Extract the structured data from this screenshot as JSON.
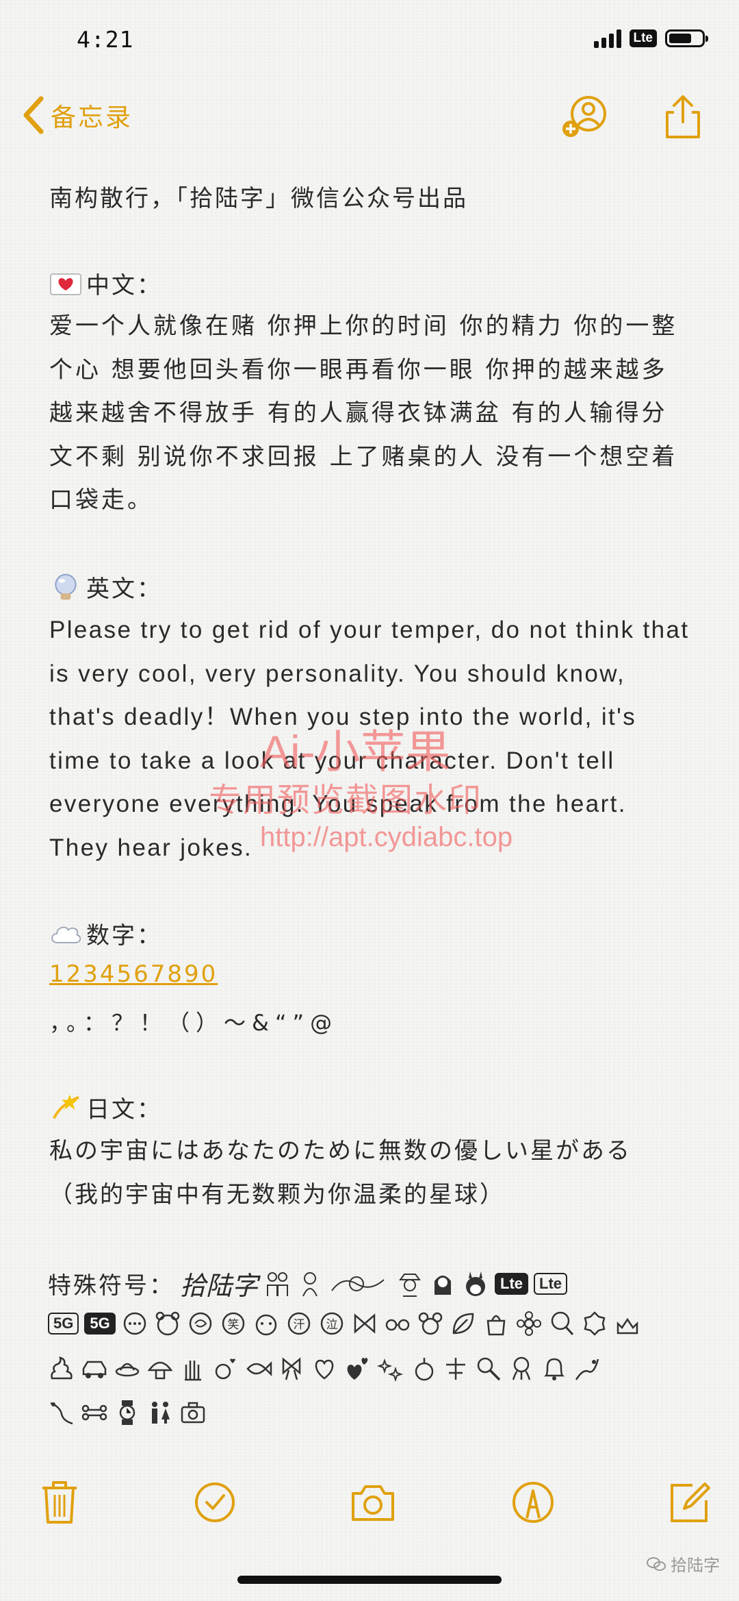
{
  "status": {
    "time": "4:21",
    "network": "Lte",
    "battery_level": 0.7
  },
  "nav": {
    "back_label": "备忘录"
  },
  "note": {
    "intro": "南构散行，「拾陆字」微信公众号出品",
    "zh_heading": "中文：",
    "zh_body": "爱一个人就像在赌 你押上你的时间 你的精力 你的一整个心 想要他回头看你一眼再看你一眼 你押的越来越多 越来越舍不得放手 有的人赢得衣钵满盆 有的人输得分文不剩 别说你不求回报 上了赌桌的人 没有一个想空着口袋走。",
    "en_heading": "英文：",
    "en_body": "Please try to get rid of your temper, do not think that is very cool, very personality. You should know, that's deadly！When you step into the world, it's time to take a look at your character. Don't tell everyone everything. You speak from the heart. They hear jokes.",
    "num_heading": "数字：",
    "digits": "1234567890",
    "punctuation": "，。：？！（）～&“”@",
    "ja_heading": "日文：",
    "ja_body_1": "私の宇宙にはあなたのために無数の優しい星がある",
    "ja_body_2": "（我的宇宙中有无数颗为你温柔的星球）",
    "symbols_heading": "特殊符号：",
    "symbols_signature": "拾陆字",
    "badge_lte": "Lte",
    "badge_5g": "5G",
    "face_labels": [
      "笑",
      "汗",
      "泣"
    ]
  },
  "watermark": {
    "line1": "Ai-小苹果",
    "line2": "专用预览截图水印",
    "line3": "http://apt.cydiabc.top"
  },
  "footer": {
    "account": "拾陆字"
  },
  "colors": {
    "accent": "#e0a00f",
    "text": "#2a2a2a",
    "watermark": "#f05a5a"
  }
}
